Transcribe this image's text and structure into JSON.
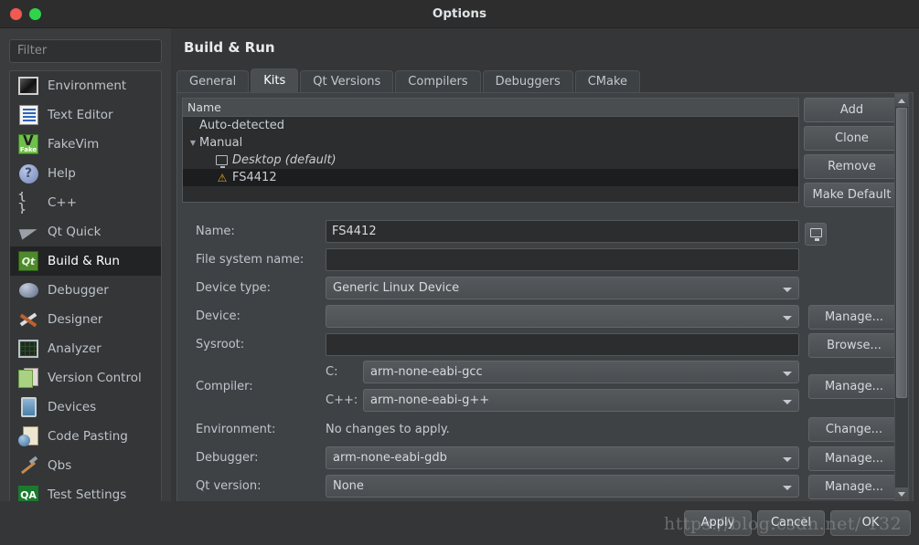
{
  "window": {
    "title": "Options",
    "controls": {
      "close": "close-button",
      "maximize": "maximize-button"
    }
  },
  "colors": {
    "window_bg": "#343638",
    "panel_bg": "#3f4245",
    "field_bg": "#2b2d2f",
    "accent_selected": "#1b1d1f",
    "warning": "#e0a92b",
    "close_button": "#f05a52",
    "maximize_button": "#2fd44c",
    "text": "#c8ccd0"
  },
  "sidebar": {
    "filter": {
      "placeholder": "Filter",
      "value": ""
    },
    "items": [
      {
        "label": "Environment",
        "icon": "environment-icon",
        "selected": false
      },
      {
        "label": "Text Editor",
        "icon": "text-editor-icon",
        "selected": false
      },
      {
        "label": "FakeVim",
        "icon": "fakevim-icon",
        "selected": false
      },
      {
        "label": "Help",
        "icon": "help-icon",
        "selected": false
      },
      {
        "label": "C++",
        "icon": "cpp-icon",
        "selected": false
      },
      {
        "label": "Qt Quick",
        "icon": "qt-quick-icon",
        "selected": false
      },
      {
        "label": "Build & Run",
        "icon": "build-and-run-icon",
        "selected": true
      },
      {
        "label": "Debugger",
        "icon": "debugger-icon",
        "selected": false
      },
      {
        "label": "Designer",
        "icon": "designer-icon",
        "selected": false
      },
      {
        "label": "Analyzer",
        "icon": "analyzer-icon",
        "selected": false
      },
      {
        "label": "Version Control",
        "icon": "version-control-icon",
        "selected": false
      },
      {
        "label": "Devices",
        "icon": "devices-icon",
        "selected": false
      },
      {
        "label": "Code Pasting",
        "icon": "code-pasting-icon",
        "selected": false
      },
      {
        "label": "Qbs",
        "icon": "qbs-icon",
        "selected": false
      },
      {
        "label": "Test Settings",
        "icon": "test-settings-icon",
        "selected": false
      }
    ]
  },
  "page": {
    "title": "Build & Run",
    "tabs": [
      {
        "label": "General",
        "active": false
      },
      {
        "label": "Kits",
        "active": true
      },
      {
        "label": "Qt Versions",
        "active": false
      },
      {
        "label": "Compilers",
        "active": false
      },
      {
        "label": "Debuggers",
        "active": false
      },
      {
        "label": "CMake",
        "active": false
      }
    ]
  },
  "kit_tree": {
    "header": "Name",
    "rows": [
      {
        "label": "Auto-detected",
        "indent": 1,
        "twisty": "",
        "icon": "",
        "italic": false,
        "selected": false
      },
      {
        "label": "Manual",
        "indent": 1,
        "twisty": "▼",
        "icon": "",
        "italic": false,
        "selected": false
      },
      {
        "label": "Desktop (default)",
        "indent": 3,
        "twisty": "",
        "icon": "monitor-icon",
        "italic": true,
        "selected": false
      },
      {
        "label": "FS4412",
        "indent": 3,
        "twisty": "",
        "icon": "warning-icon",
        "italic": false,
        "selected": true
      }
    ]
  },
  "kit_buttons": {
    "add": "Add",
    "clone": "Clone",
    "remove": "Remove",
    "make_default": "Make Default"
  },
  "form": {
    "name": {
      "label": "Name:",
      "value": "FS4412",
      "side_button_icon": "monitor-icon"
    },
    "file_system_name": {
      "label": "File system name:",
      "value": ""
    },
    "device_type": {
      "label": "Device type:",
      "value": "Generic Linux Device"
    },
    "device": {
      "label": "Device:",
      "value": "",
      "button": "Manage..."
    },
    "sysroot": {
      "label": "Sysroot:",
      "value": "",
      "button": "Browse..."
    },
    "compiler": {
      "label": "Compiler:",
      "c_label": "C:",
      "c_value": "arm-none-eabi-gcc",
      "cpp_label": "C++:",
      "cpp_value": "arm-none-eabi-g++",
      "button": "Manage..."
    },
    "environment": {
      "label": "Environment:",
      "value": "No changes to apply.",
      "button": "Change..."
    },
    "debugger": {
      "label": "Debugger:",
      "value": "arm-none-eabi-gdb",
      "button": "Manage..."
    },
    "qt_version": {
      "label": "Qt version:",
      "value": "None",
      "button": "Manage..."
    }
  },
  "dialog_buttons": {
    "apply": "Apply",
    "cancel": "Cancel",
    "ok": "OK"
  },
  "watermark": {
    "text": "https://blog.csdn.net/  132"
  }
}
